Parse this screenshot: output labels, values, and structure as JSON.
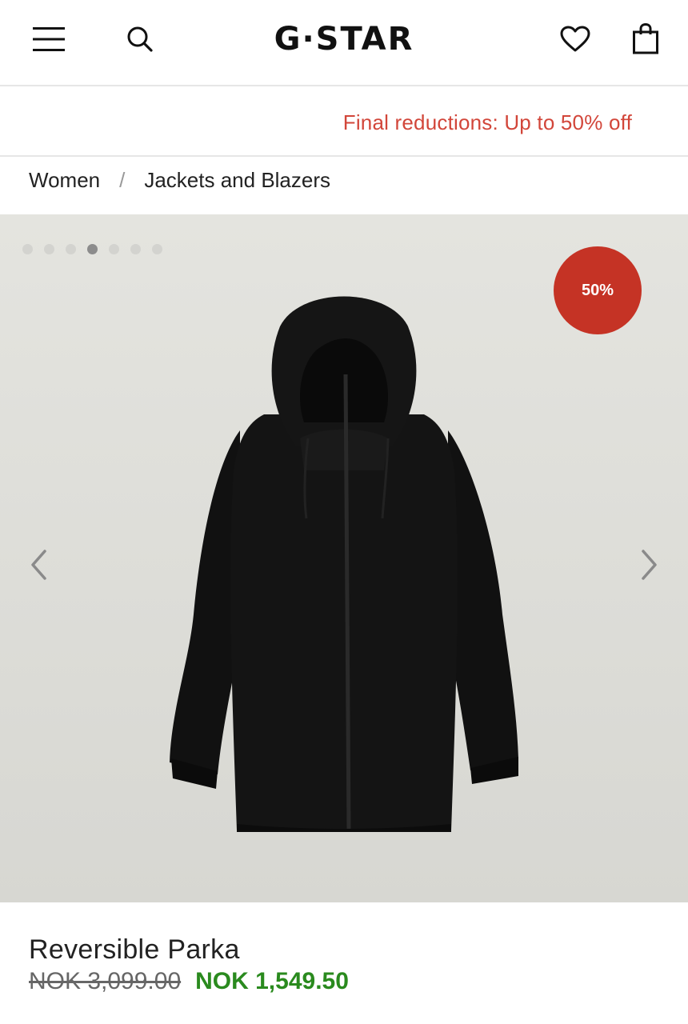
{
  "header": {
    "logo_text": "G-STAR",
    "icons": [
      "menu-icon",
      "search-icon",
      "heart-icon",
      "shopping-bag-icon"
    ]
  },
  "promo": {
    "text": "Final reductions: Up to 50% off",
    "color": "#d2463a"
  },
  "breadcrumb": {
    "items": [
      "Women",
      "Jackets and Blazers"
    ],
    "separator": "/"
  },
  "gallery": {
    "total_images": 7,
    "active_index": 4,
    "badge": "50%",
    "badge_color": "#c53325"
  },
  "product": {
    "name": "Reversible Parka",
    "old_price": "NOK 3,099.00",
    "new_price": "NOK 1,549.50",
    "new_price_color": "#2a8a1e"
  }
}
